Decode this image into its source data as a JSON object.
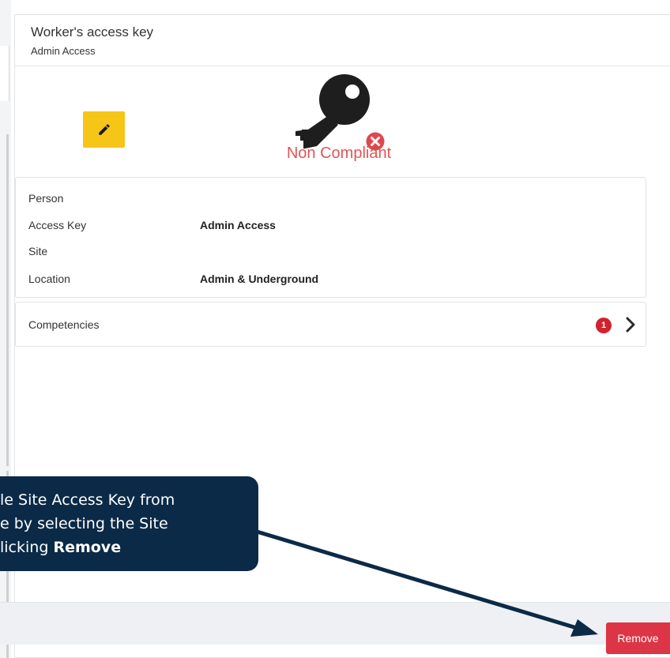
{
  "panel": {
    "title": "Worker's access key",
    "subtitle": "Admin Access"
  },
  "status": {
    "text": "Non Compliant",
    "color": "#e05555"
  },
  "details": [
    {
      "label": "Person",
      "value": ""
    },
    {
      "label": "Access Key",
      "value": "Admin Access"
    },
    {
      "label": "Site",
      "value": ""
    },
    {
      "label": "Location",
      "value": "Admin & Underground"
    }
  ],
  "competencies": {
    "label": "Competencies",
    "count": "1"
  },
  "footer": {
    "remove_label": "Remove"
  },
  "callout": {
    "line1": "le Site Access Key from",
    "line2": "e by selecting the Site",
    "line3_prefix": "licking ",
    "line3_bold": "Remove"
  },
  "colors": {
    "edit_button": "#f5c518",
    "remove_button": "#dc3545",
    "badge": "#d0232f",
    "callout_bg": "#0b2a47"
  },
  "icons": {
    "edit": "pencil-icon",
    "key": "key-icon",
    "status": "error-x-icon",
    "expand": "chevron-right-icon"
  }
}
